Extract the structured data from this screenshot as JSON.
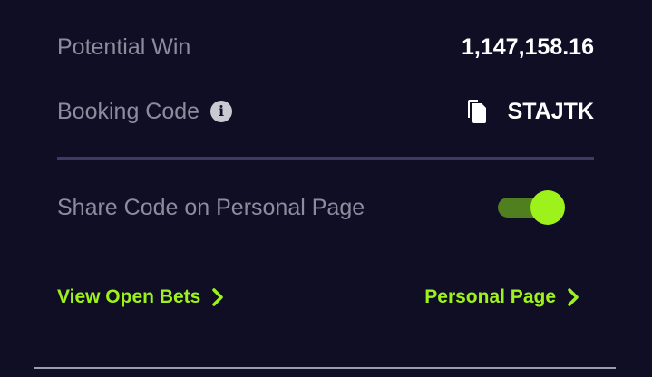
{
  "potential_win": {
    "label": "Potential Win",
    "value": "1,147,158.16"
  },
  "booking_code": {
    "label": "Booking Code",
    "info_icon": "info-icon",
    "copy_icon": "copy-icon",
    "code": "STAJTK"
  },
  "share": {
    "label": "Share Code on Personal Page",
    "enabled": true
  },
  "links": {
    "open_bets": "View Open Bets",
    "personal_page": "Personal Page"
  },
  "colors": {
    "background": "#0f0e24",
    "accent": "#9ef21b",
    "label": "#8c8c9e",
    "divider": "#3e3a66"
  }
}
